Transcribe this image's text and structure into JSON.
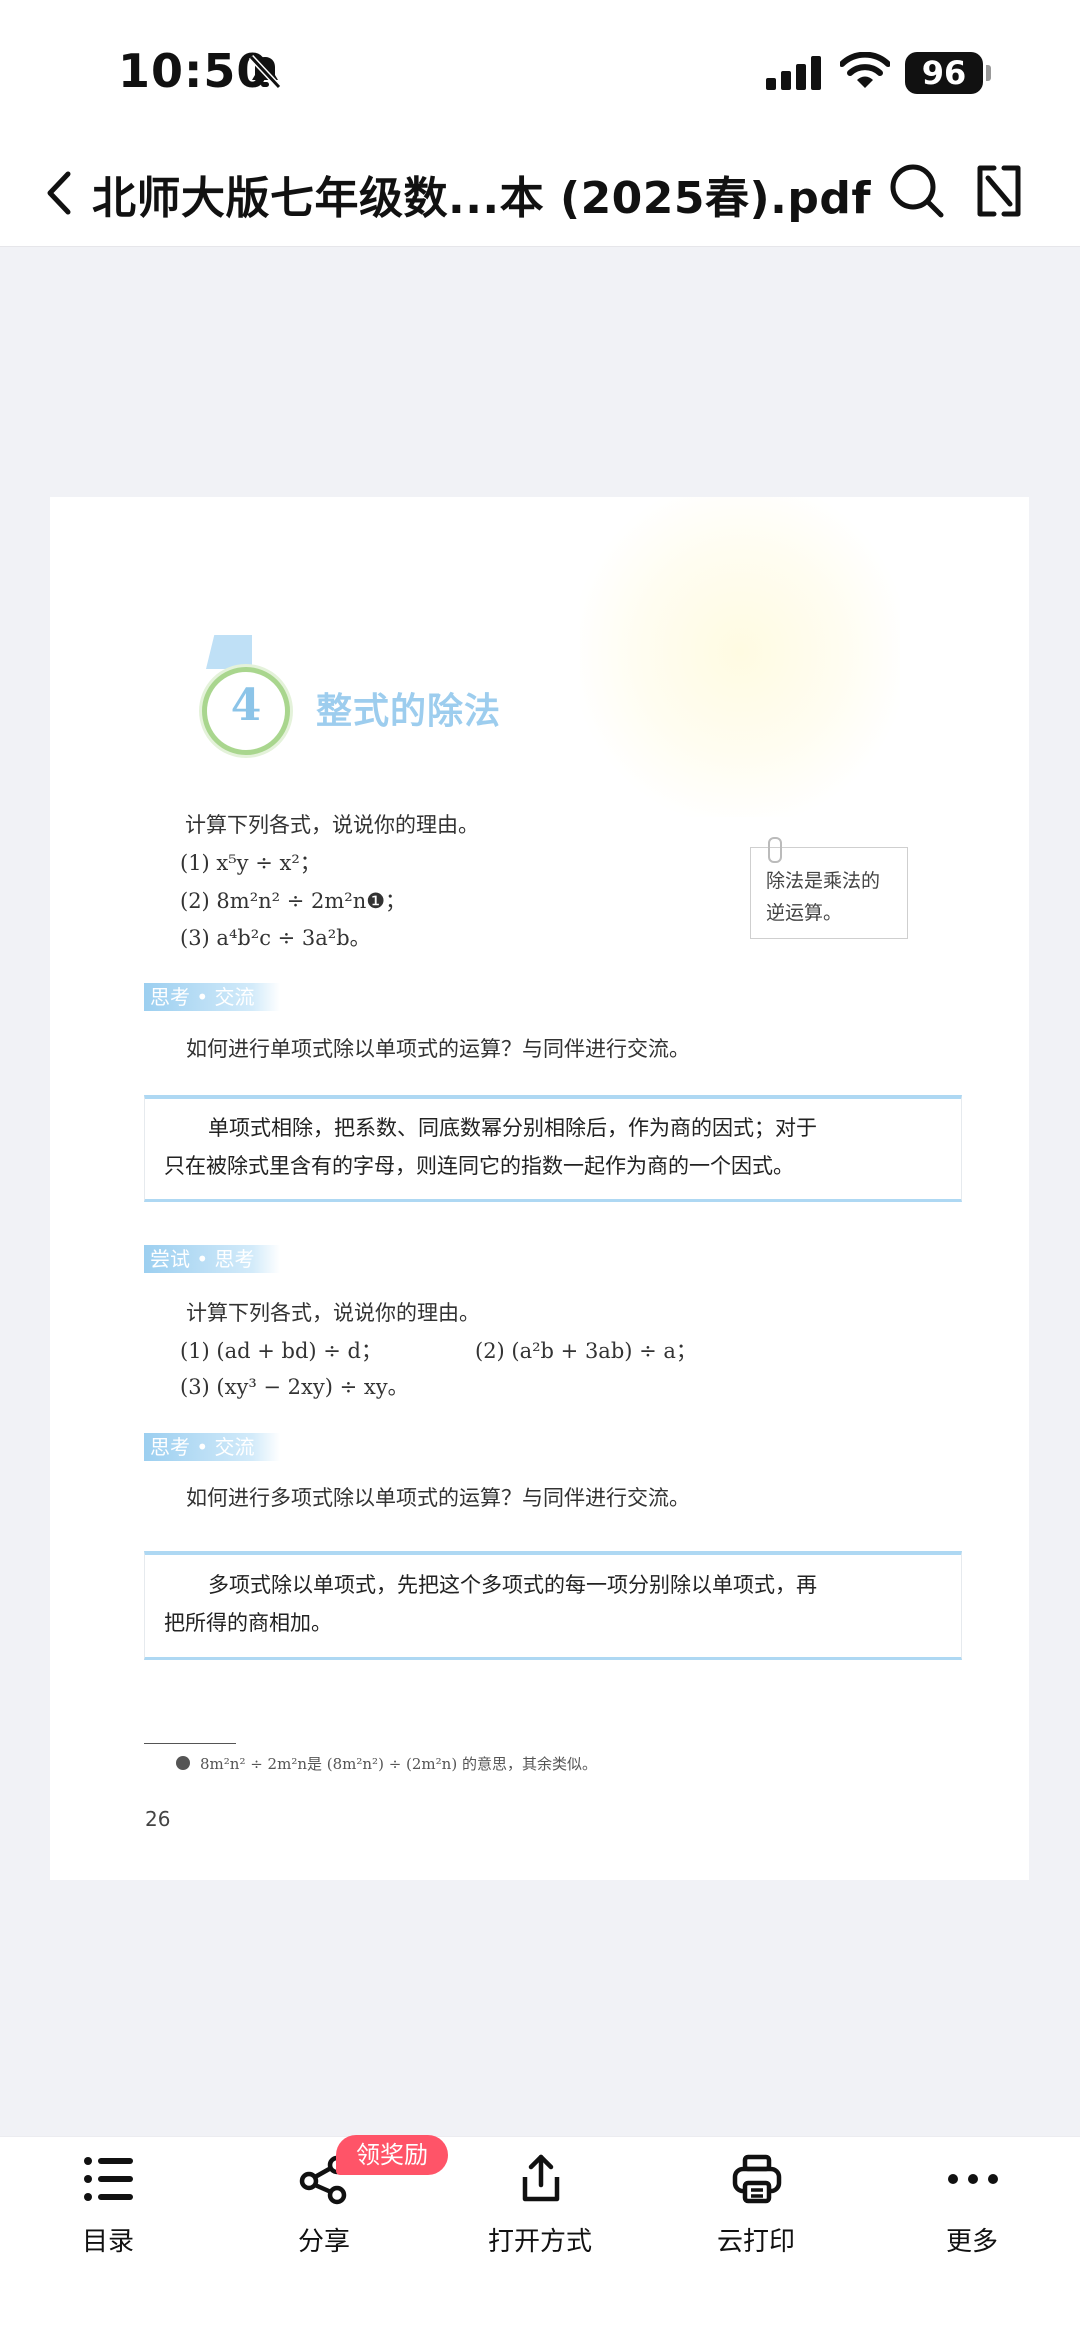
{
  "status_bar": {
    "time": "10:50",
    "battery": "96"
  },
  "header": {
    "title": "北师大版七年级数...本 (2025春).pdf"
  },
  "page": {
    "section_number": "4",
    "section_title": "整式的除法",
    "intro": "计算下列各式，说说你的理由。",
    "exercises_1": [
      "(1) x⁵y ÷ x²；",
      "(2) 8m²n² ÷ 2m²n❶；",
      "(3) a⁴b²c ÷ 3a²b。"
    ],
    "side_note": [
      "除法是乘法的",
      "逆运算。"
    ],
    "tag_1": "思考 • 交流",
    "question_1": "如何进行单项式除以单项式的运算？与同伴进行交流。",
    "rule_1": [
      "单项式相除，把系数、同底数幂分别相除后，作为商的因式；对于",
      "只在被除式里含有的字母，则连同它的指数一起作为商的一个因式。"
    ],
    "tag_2": "尝试 • 思考",
    "intro_2": "计算下列各式，说说你的理由。",
    "exercises_2": [
      "(1) (ad + bd) ÷ d；",
      "(2) (a²b + 3ab) ÷ a；",
      "(3) (xy³ − 2xy) ÷ xy。"
    ],
    "tag_3": "思考 • 交流",
    "question_2": "如何进行多项式除以单项式的运算？与同伴进行交流。",
    "rule_2": [
      "多项式除以单项式，先把这个多项式的每一项分别除以单项式，再",
      "把所得的商相加。"
    ],
    "footnote": "8m²n² ÷ 2m²n是 (8m²n²) ÷ (2m²n) 的意思，其余类似。",
    "page_number": "26"
  },
  "toolbar": {
    "items": [
      {
        "label": "目录",
        "icon": "list-icon"
      },
      {
        "label": "分享",
        "icon": "share-icon"
      },
      {
        "label": "打开方式",
        "icon": "upload-icon"
      },
      {
        "label": "云打印",
        "icon": "print-icon"
      },
      {
        "label": "更多",
        "icon": "more-icon"
      }
    ],
    "share_badge": "领奖励"
  }
}
